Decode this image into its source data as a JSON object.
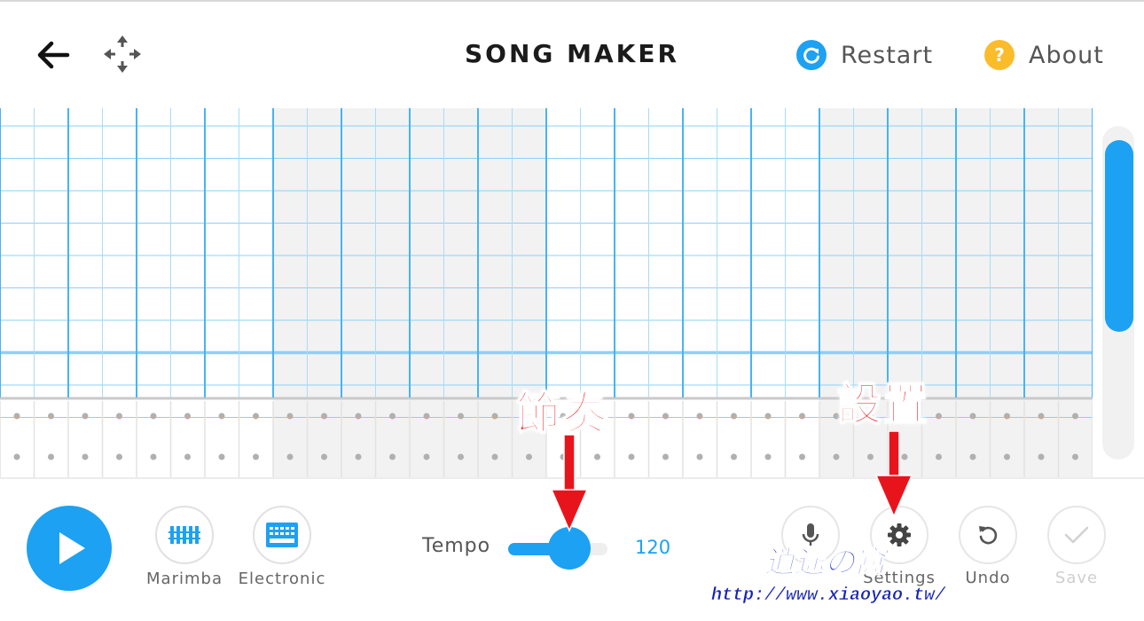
{
  "header": {
    "title": "SONG MAKER",
    "restart_label": "Restart",
    "about_label": "About",
    "back_icon": "arrow-left-icon",
    "move_icon": "move-arrows-icon"
  },
  "grid": {
    "columns": 32,
    "melody_rows": 9,
    "rhythm_rows": 2
  },
  "toolbar": {
    "play_icon": "play-icon",
    "instruments": [
      {
        "label": "Marimba",
        "icon": "marimba-icon"
      },
      {
        "label": "Electronic",
        "icon": "electronic-keyboard-icon"
      }
    ],
    "tempo_label": "Tempo",
    "tempo_value": "120",
    "tempo_fraction": 0.62,
    "mic_label": "Mic",
    "settings_label": "Settings",
    "undo_label": "Undo",
    "save_label": "Save"
  },
  "annotations": {
    "tempo_note": "節奏",
    "settings_note": "設置"
  },
  "watermark": {
    "title": "逍遙の窩",
    "url": "http://www.xiaoyao.tw/"
  },
  "colors": {
    "accent": "#1da1f2",
    "about": "#fbbc2c",
    "annotation": "#e8141c",
    "watermark": "#1523b8"
  }
}
